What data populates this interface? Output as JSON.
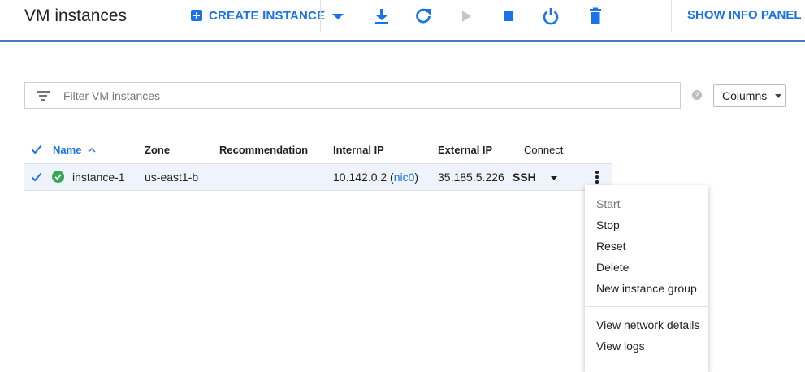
{
  "header": {
    "title": "VM instances",
    "create_label": "CREATE INSTANCE",
    "info_panel_label": "SHOW INFO PANEL",
    "toolbar_icons": [
      "dropdown-caret-icon",
      "download-icon",
      "refresh-icon",
      "start-icon",
      "stop-icon",
      "power-icon",
      "delete-icon"
    ]
  },
  "filter": {
    "placeholder": "Filter VM instances",
    "value": ""
  },
  "columns_button": {
    "label": "Columns"
  },
  "table": {
    "headers": {
      "name": "Name",
      "zone": "Zone",
      "recommendation": "Recommendation",
      "internal_ip": "Internal IP",
      "external_ip": "External IP",
      "connect": "Connect"
    },
    "sort_indicator": "^",
    "rows": [
      {
        "selected": true,
        "status": "running",
        "name": "instance-1",
        "zone": "us-east1-b",
        "recommendation": "",
        "internal_ip_addr": "10.142.0.2 (",
        "internal_ip_nic": "nic0",
        "internal_ip_close": ")",
        "external_ip": "35.185.5.226",
        "connect": "SSH"
      }
    ]
  },
  "context_menu": {
    "items": [
      {
        "label": "Start",
        "disabled": true
      },
      {
        "label": "Stop"
      },
      {
        "label": "Reset"
      },
      {
        "label": "Delete"
      },
      {
        "label": "New instance group"
      },
      {
        "label": "View network details"
      },
      {
        "label": "View logs"
      }
    ]
  },
  "colors": {
    "accent": "#1a73e8",
    "header_border": "#4a78c2",
    "selected_row": "#eef3fc",
    "status_ok": "#34a853"
  }
}
